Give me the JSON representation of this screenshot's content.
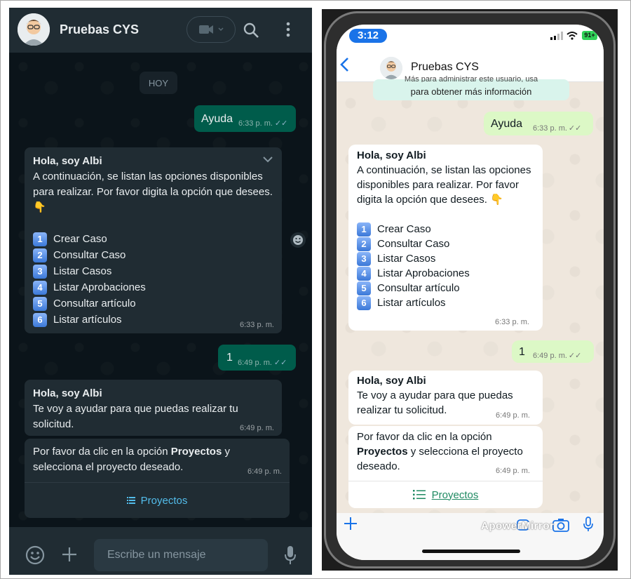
{
  "web": {
    "contact_name": "Pruebas CYS",
    "day_label": "HOY",
    "msg_ayuda": {
      "text": "Ayuda",
      "time": "6:33 p. m."
    },
    "menu_msg": {
      "title": "Hola, soy Albi",
      "intro": "A continuación, se listan las opciones disponibles para realizar. Por favor digita la opción que desees. 👇",
      "options": [
        {
          "num": "1",
          "label": "Crear Caso"
        },
        {
          "num": "2",
          "label": "Consultar Caso"
        },
        {
          "num": "3",
          "label": "Listar Casos"
        },
        {
          "num": "4",
          "label": "Listar Aprobaciones"
        },
        {
          "num": "5",
          "label": "Consultar artículo"
        },
        {
          "num": "6",
          "label": "Listar artículos"
        }
      ],
      "time": "6:33 p. m."
    },
    "msg_one": {
      "text": "1",
      "time": "6:49 p. m."
    },
    "help_msg": {
      "title": "Hola, soy Albi",
      "text": "Te voy a ayudar para que puedas realizar tu solicitud.",
      "time": "6:49 p. m."
    },
    "click_msg": {
      "pre": "Por favor da clic en la opción ",
      "bold": "Proyectos",
      "post": " y selecciona el proyecto deseado.",
      "time": "6:49 p. m.",
      "button": "Proyectos"
    },
    "input_placeholder": "Escribe un mensaje"
  },
  "phone": {
    "status_time": "3:12",
    "battery": "91+",
    "contact_name": "Pruebas CYS",
    "partial_notice_line1": "Más para administrar este usuario, usa",
    "partial_notice_line2": "para obtener más información",
    "msg_ayuda": {
      "text": "Ayuda",
      "time": "6:33 p. m."
    },
    "menu_msg": {
      "title": "Hola, soy Albi",
      "intro": "A continuación, se listan las opciones disponibles para realizar. Por favor digita la opción que desees. 👇",
      "options": [
        {
          "num": "1",
          "label": "Crear Caso"
        },
        {
          "num": "2",
          "label": "Consultar Caso"
        },
        {
          "num": "3",
          "label": "Listar Casos"
        },
        {
          "num": "4",
          "label": "Listar Aprobaciones"
        },
        {
          "num": "5",
          "label": "Consultar artículo"
        },
        {
          "num": "6",
          "label": "Listar artículos"
        }
      ],
      "time": "6:33 p. m."
    },
    "msg_one": {
      "text": "1",
      "time": "6:49 p. m."
    },
    "help_msg": {
      "title": "Hola, soy Albi",
      "text": "Te voy a ayudar para que puedas realizar tu solicitud.",
      "time": "6:49 p. m."
    },
    "click_msg": {
      "pre": "Por favor da clic en la opción ",
      "bold": "Proyectos",
      "post": " y selecciona el proyecto deseado.",
      "time": "6:49 p. m.",
      "button": "Proyectos"
    },
    "watermark": "ApowerMirror"
  },
  "colors": {
    "web_bg": "#0b141a",
    "web_header": "#202c33",
    "web_out_bubble": "#005c4b",
    "web_in_bubble": "#202c33",
    "web_link": "#53bdeb",
    "phone_out_bubble": "#dcf8c6",
    "phone_link": "#1f8a62",
    "ios_blue": "#1a73e8"
  }
}
